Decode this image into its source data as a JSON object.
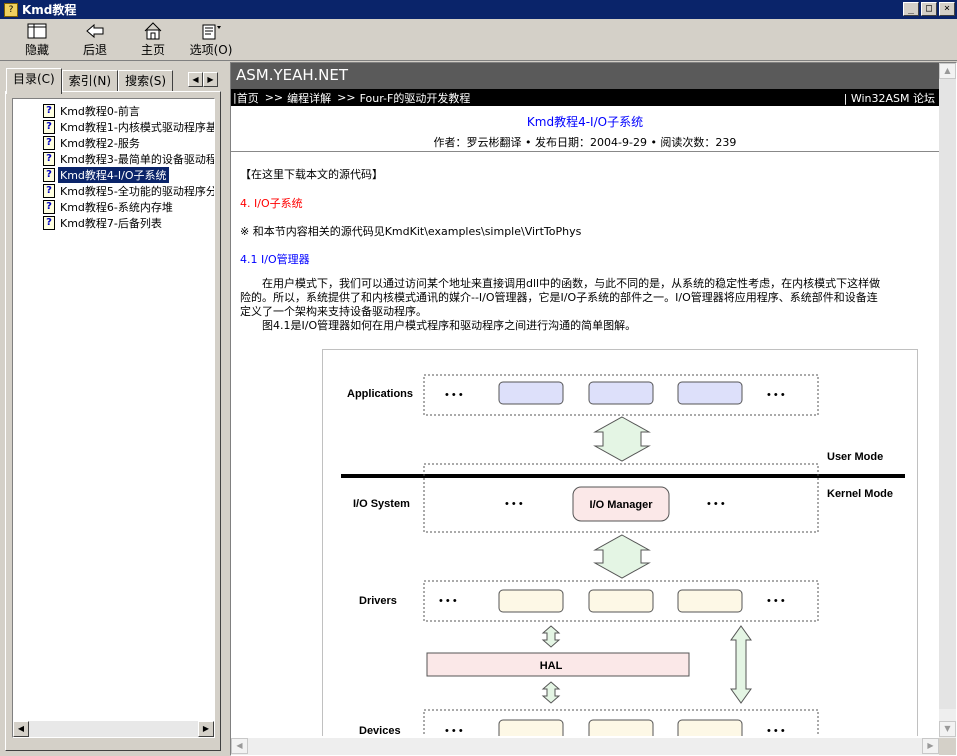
{
  "window": {
    "title": "Kmd教程",
    "controls": [
      "_",
      "□",
      "×"
    ]
  },
  "toolbar": {
    "hide_label": "隐藏",
    "back_label": "后退",
    "home_label": "主页",
    "options_label": "选项(O)"
  },
  "left_tabs": {
    "contents": "目录(C)",
    "index": "索引(N)",
    "search": "搜索(S)"
  },
  "toc": {
    "items": [
      {
        "label": "Kmd教程0-前言",
        "selected": false
      },
      {
        "label": "Kmd教程1-内核模式驱动程序基",
        "selected": false
      },
      {
        "label": "Kmd教程2-服务",
        "selected": false
      },
      {
        "label": "Kmd教程3-最简单的设备驱动程",
        "selected": false
      },
      {
        "label": "Kmd教程4-I/O子系统",
        "selected": true
      },
      {
        "label": "Kmd教程5-全功能的驱动程序分",
        "selected": false
      },
      {
        "label": "Kmd教程6-系统内存堆",
        "selected": false
      },
      {
        "label": "Kmd教程7-后备列表",
        "selected": false
      }
    ]
  },
  "page": {
    "site_logo": "ASM.YEAH.NET",
    "nav_home": "首页",
    "nav_section": "编程详解",
    "nav_topic": "Four-F的驱动开发教程",
    "nav_right": "| Win32ASM 论坛",
    "nav_sep": "| ",
    "nav_arrow": ">>",
    "title": "Kmd教程4-I/O子系统",
    "byline": "作者：罗云彬翻译 • 发布日期：2004-9-29 • 阅读次数：239",
    "download": "【在这里下载本文的源代码】",
    "section_heading": "4. I/O子系统",
    "source_note": "※ 和本节内容相关的源代码见KmdKit\\examples\\simple\\VirtToPhys",
    "subsection": "4.1 I/O管理器",
    "paragraph_lines": [
      "　　在用户模式下，我们可以通过访问某个地址来直接调用dll中的函数，与此不同的是，从系统的稳定性考虑，在内核模式下这样做",
      "险的。所以，系统提供了和内核模式通讯的媒介--I/O管理器，它是I/O子系统的部件之一。I/O管理器将应用程序、系统部件和设备连",
      "定义了一个架构来支持设备驱动程序。",
      "　　图4.1是I/O管理器如何在用户模式程序和驱动程序之间进行沟通的简单图解。"
    ]
  },
  "diagram": {
    "applications": "Applications",
    "io_system": "I/O System",
    "drivers": "Drivers",
    "devices": "Devices",
    "user_mode": "User Mode",
    "kernel_mode": "Kernel Mode",
    "io_manager": "I/O Manager",
    "hal": "HAL",
    "dots": "• • •"
  },
  "colors": {
    "title_bar": "#0a246a",
    "banner": "#5a5a5a",
    "app_box": "#dde0fa",
    "driver_box": "#fdf8e6",
    "io_manager_box": "#fbe8e8",
    "arrow_fill": "#e4f5e4",
    "link_blue": "#0000ff",
    "heading_red": "#ff0000"
  }
}
